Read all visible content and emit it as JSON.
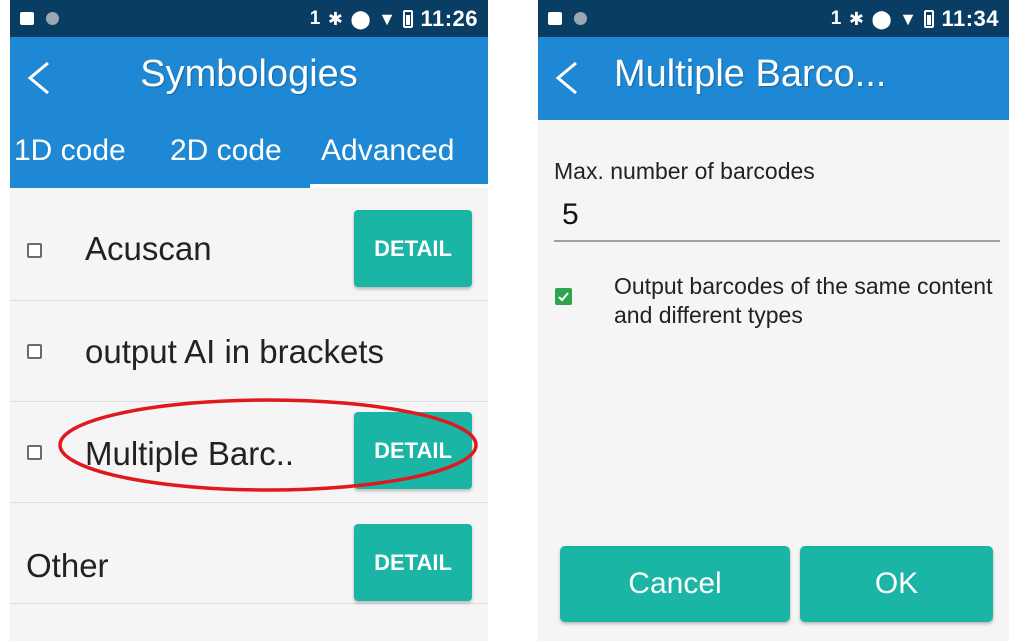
{
  "left_screen": {
    "status_bar": {
      "sim": "1",
      "time": "11:26"
    },
    "title": "Symbologies",
    "tabs": [
      "1D code",
      "2D code",
      "Advanced"
    ],
    "selected_tab": "Advanced",
    "rows": [
      {
        "label": "Acuscan",
        "checked": false,
        "has_detail": true
      },
      {
        "label": "output AI in brackets",
        "checked": false,
        "has_detail": false
      },
      {
        "label": "Multiple Barc..",
        "checked": false,
        "has_detail": true
      },
      {
        "label": "Other",
        "checked": false,
        "has_detail": true
      }
    ],
    "detail_label": "DETAIL"
  },
  "right_screen": {
    "status_bar": {
      "sim": "1",
      "time": "11:34"
    },
    "title": "Multiple Barco...",
    "max_label": "Max. number of barcodes",
    "max_value": "5",
    "option_text": "Output barcodes of the same content and different types",
    "option_checked": true,
    "cancel_label": "Cancel",
    "ok_label": "OK"
  },
  "colors": {
    "status_bar": "#0a3d63",
    "app_bar": "#1e88d4",
    "button": "#1ab5a5",
    "checkbox_checked": "#2ea44f",
    "highlight": "#e0191d"
  },
  "icons": [
    "image-icon",
    "circle-icon",
    "bluetooth-icon",
    "data-saver-icon",
    "wifi-icon",
    "battery-icon",
    "back-arrow-icon",
    "checkbox-icon",
    "checkmark-icon"
  ]
}
